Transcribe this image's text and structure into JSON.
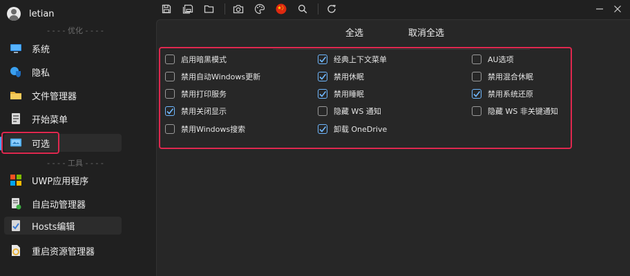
{
  "accent": "#6fb8ff",
  "highlight": "#e0284f",
  "user": {
    "name": "letian",
    "avatar_icon": "user-avatar-icon"
  },
  "sections": {
    "optimize": "- - - - 优化 - - - -",
    "tools": "- - - - 工具 - - - -"
  },
  "nav": [
    {
      "label": "系统",
      "icon": "monitor-icon"
    },
    {
      "label": "隐私",
      "icon": "shield-icon"
    },
    {
      "label": "文件管理器",
      "icon": "folder-icon"
    },
    {
      "label": "开始菜单",
      "icon": "start-menu-icon"
    },
    {
      "label": "可选",
      "icon": "optional-features-icon",
      "selected": true
    },
    {
      "label": "UWP应用程序",
      "icon": "apps-grid-icon"
    },
    {
      "label": "自启动管理器",
      "icon": "startup-icon"
    },
    {
      "label": "Hosts编辑",
      "icon": "hosts-icon"
    },
    {
      "label": "重启资源管理器",
      "icon": "restart-explorer-icon"
    }
  ],
  "toolbar": [
    {
      "icon": "save-icon"
    },
    {
      "icon": "save-all-icon"
    },
    {
      "icon": "open-folder-icon"
    },
    {
      "icon": "camera-icon"
    },
    {
      "icon": "palette-icon"
    },
    {
      "icon": "china-flag-icon"
    },
    {
      "icon": "search-icon"
    },
    {
      "icon": "refresh-icon"
    }
  ],
  "window": {
    "minimize_icon": "minimize-icon",
    "close_icon": "close-icon"
  },
  "tabs": {
    "select_all": "全选",
    "deselect_all": "取消全选"
  },
  "options": [
    [
      {
        "label": "启用暗黑模式",
        "checked": false
      },
      {
        "label": "禁用自动Windows更新",
        "checked": false
      },
      {
        "label": "禁用打印服务",
        "checked": false
      },
      {
        "label": "禁用关闭显示",
        "checked": true
      },
      {
        "label": "禁用Windows搜索",
        "checked": false
      }
    ],
    [
      {
        "label": "经典上下文菜单",
        "checked": true
      },
      {
        "label": "禁用休眠",
        "checked": true
      },
      {
        "label": "禁用睡眠",
        "checked": true
      },
      {
        "label": "隐藏 WS 通知",
        "checked": false
      },
      {
        "label": "卸载 OneDrive",
        "checked": true
      }
    ],
    [
      {
        "label": "AU选项",
        "checked": false
      },
      {
        "label": "禁用混合休眠",
        "checked": false
      },
      {
        "label": "禁用系统还原",
        "checked": true
      },
      {
        "label": "隐藏 WS 非关键通知",
        "checked": false
      }
    ]
  ]
}
